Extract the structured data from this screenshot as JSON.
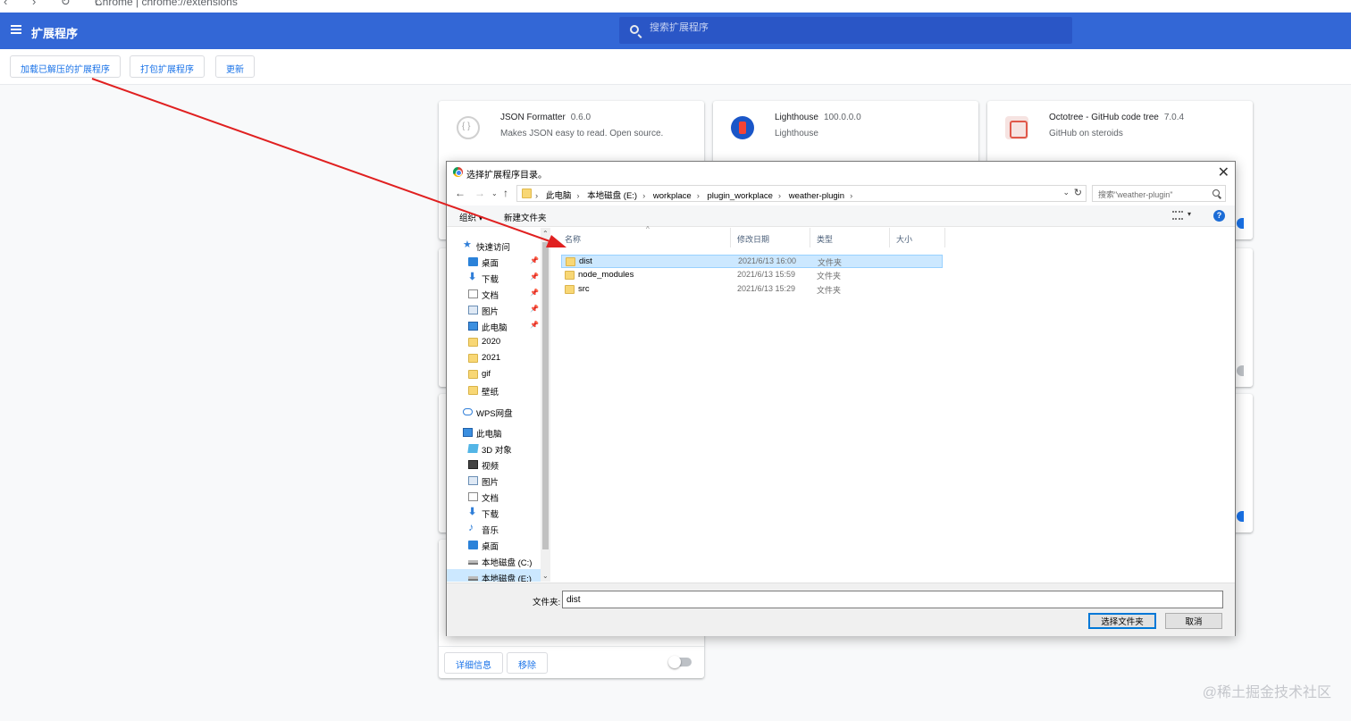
{
  "browser": {
    "nav_glyphs": "‹ › ↻ ⌂",
    "url": "Chrome | chrome://extensions"
  },
  "header": {
    "title": "扩展程序",
    "search_placeholder": "搜索扩展程序"
  },
  "toolbar": {
    "load_unpacked": "加载已解压的扩展程序",
    "pack": "打包扩展程序",
    "update": "更新"
  },
  "extensions": [
    {
      "name": "JSON Formatter",
      "version": "0.6.0",
      "description": "Makes JSON easy to read. Open source.",
      "icon": "json-formatter-icon"
    },
    {
      "name": "Lighthouse",
      "version": "100.0.0.0",
      "description": "Lighthouse",
      "icon": "lighthouse-icon"
    },
    {
      "name": "Octotree - GitHub code tree",
      "version": "7.0.4",
      "description": "GitHub on steroids",
      "icon": "octotree-icon"
    }
  ],
  "bottom_card": {
    "details": "详细信息",
    "remove": "移除"
  },
  "dialog": {
    "title": "选择扩展程序目录。",
    "breadcrumb": [
      "此电脑",
      "本地磁盘 (E:)",
      "workplace",
      "plugin_workplace",
      "weather-plugin"
    ],
    "search_placeholder": "搜索\"weather-plugin\"",
    "organize": "组织 ▾",
    "new_folder": "新建文件夹",
    "help": "?",
    "nav_items": [
      {
        "label": "快速访问",
        "icon": "star-icon"
      },
      {
        "label": "桌面",
        "icon": "desktop-icon",
        "pinned": true
      },
      {
        "label": "下载",
        "icon": "download-icon",
        "pinned": true
      },
      {
        "label": "文档",
        "icon": "document-icon",
        "pinned": true
      },
      {
        "label": "图片",
        "icon": "pictures-icon",
        "pinned": true
      },
      {
        "label": "此电脑",
        "icon": "computer-icon",
        "pinned": true
      },
      {
        "label": "2020",
        "icon": "folder-icon"
      },
      {
        "label": "2021",
        "icon": "folder-icon"
      },
      {
        "label": "gif",
        "icon": "folder-icon"
      },
      {
        "label": "壁纸",
        "icon": "folder-icon"
      },
      {
        "label": "WPS网盘",
        "icon": "cloud-icon"
      },
      {
        "label": "此电脑",
        "icon": "computer-icon"
      },
      {
        "label": "3D 对象",
        "icon": "3d-objects-icon"
      },
      {
        "label": "视频",
        "icon": "video-icon"
      },
      {
        "label": "图片",
        "icon": "pictures-icon"
      },
      {
        "label": "文档",
        "icon": "document-icon"
      },
      {
        "label": "下载",
        "icon": "download-icon"
      },
      {
        "label": "音乐",
        "icon": "music-icon"
      },
      {
        "label": "桌面",
        "icon": "desktop-icon"
      },
      {
        "label": "本地磁盘 (C:)",
        "icon": "drive-icon"
      },
      {
        "label": "本地磁盘 (E:)",
        "icon": "drive-icon",
        "selected": true
      }
    ],
    "columns": [
      "名称",
      "修改日期",
      "类型",
      "大小"
    ],
    "files": [
      {
        "name": "dist",
        "date": "2021/6/13 16:00",
        "type": "文件夹",
        "selected": true
      },
      {
        "name": "node_modules",
        "date": "2021/6/13 15:59",
        "type": "文件夹"
      },
      {
        "name": "src",
        "date": "2021/6/13 15:29",
        "type": "文件夹"
      }
    ],
    "folder_label": "文件夹:",
    "folder_value": "dist",
    "select_button": "选择文件夹",
    "cancel_button": "取消"
  },
  "watermark": "@稀土掘金技术社区",
  "colors": {
    "header_bg": "#3367d6",
    "accent": "#1a73e8",
    "selection": "#cce8ff",
    "annotation_arrow": "#e02020"
  }
}
